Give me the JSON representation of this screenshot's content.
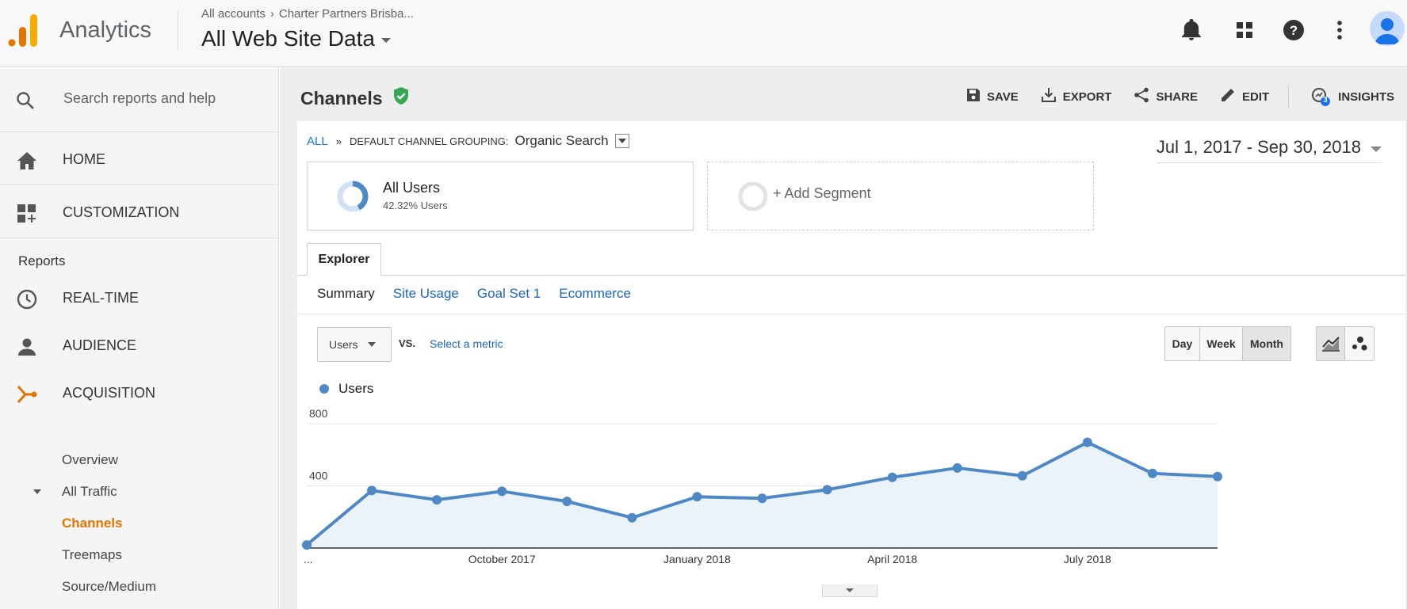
{
  "header": {
    "app_name": "Analytics",
    "breadcrumb": [
      "All accounts",
      "Charter Partners Brisba..."
    ],
    "view_name": "All Web Site Data",
    "icons": [
      "bell-icon",
      "apps-icon",
      "help-icon",
      "more-icon",
      "avatar"
    ]
  },
  "sidebar": {
    "search_placeholder": "Search reports and help",
    "home_label": "HOME",
    "customization_label": "CUSTOMIZATION",
    "reports_label": "Reports",
    "realtime_label": "REAL-TIME",
    "audience_label": "AUDIENCE",
    "acquisition_label": "ACQUISITION",
    "sub_items": {
      "overview": "Overview",
      "all_traffic": "All Traffic",
      "channels": "Channels",
      "treemaps": "Treemaps",
      "source_medium": "Source/Medium"
    },
    "active_color": "#e37400"
  },
  "report": {
    "title": "Channels",
    "actions": {
      "save": "SAVE",
      "export": "EXPORT",
      "share": "SHARE",
      "edit": "EDIT",
      "insights": "INSIGHTS",
      "insights_badge": "3"
    },
    "path": {
      "all": "ALL",
      "sep": "»",
      "grouping": "DEFAULT CHANNEL GROUPING:",
      "value": "Organic Search"
    },
    "date_range": "Jul 1, 2017 - Sep 30, 2018",
    "segments": {
      "primary_name": "All Users",
      "primary_sub": "42.32% Users",
      "add_label": "+ Add Segment"
    },
    "explorer_tab": "Explorer",
    "subtabs": [
      "Summary",
      "Site Usage",
      "Goal Set 1",
      "Ecommerce"
    ],
    "metric_select": "Users",
    "vs_label": "VS.",
    "select_metric_label": "Select a metric",
    "periods": [
      "Day",
      "Week",
      "Month"
    ],
    "selected_period": "Month"
  },
  "chart_data": {
    "type": "line",
    "series": [
      {
        "name": "Users",
        "color": "#4f89c5",
        "values": [
          20,
          370,
          310,
          365,
          300,
          195,
          330,
          320,
          375,
          455,
          515,
          465,
          680,
          480,
          460
        ]
      }
    ],
    "ylim": [
      0,
      800
    ],
    "y_ticks": [
      "800",
      "400"
    ],
    "x_tick_labels": [
      {
        "label": "...",
        "index": 0
      },
      {
        "label": "October 2017",
        "index": 3
      },
      {
        "label": "January 2018",
        "index": 6
      },
      {
        "label": "April 2018",
        "index": 9
      },
      {
        "label": "July 2018",
        "index": 12
      }
    ],
    "area_fill": "#eaf2fa",
    "grid": true
  }
}
